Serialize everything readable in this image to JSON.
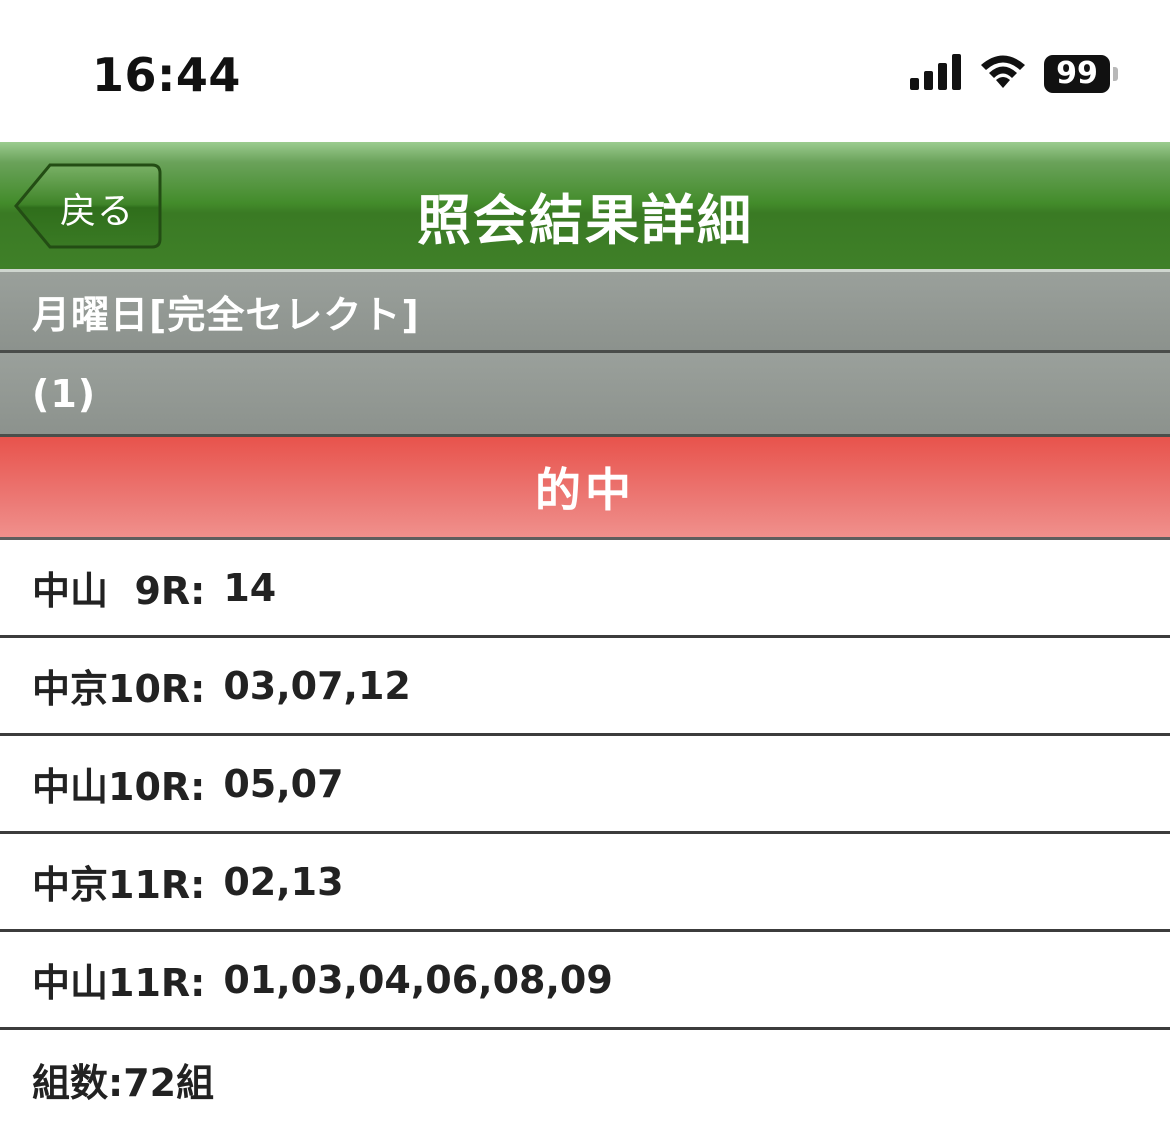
{
  "status_bar": {
    "time": "16:44",
    "signal_icon": "cellular-signal-icon",
    "wifi_icon": "wifi-icon",
    "battery_level": "99"
  },
  "nav": {
    "back_label": "戻る",
    "title": "照会結果詳細"
  },
  "bet": {
    "day_type": "月曜日[完全セレクト]",
    "index": "(1)",
    "result": "的中"
  },
  "races": [
    {
      "label": "中山  9R:",
      "numbers": "14"
    },
    {
      "label": "中京10R:",
      "numbers": "03,07,12"
    },
    {
      "label": "中山10R:",
      "numbers": "05,07"
    },
    {
      "label": "中京11R:",
      "numbers": "02,13"
    },
    {
      "label": "中山11R:",
      "numbers": "01,03,04,06,08,09"
    }
  ],
  "summary": {
    "combinations": "組数:72組"
  },
  "colors": {
    "nav_green": "#438c2b",
    "header_gray": "#8c928d",
    "hit_red": "#e8534c"
  }
}
